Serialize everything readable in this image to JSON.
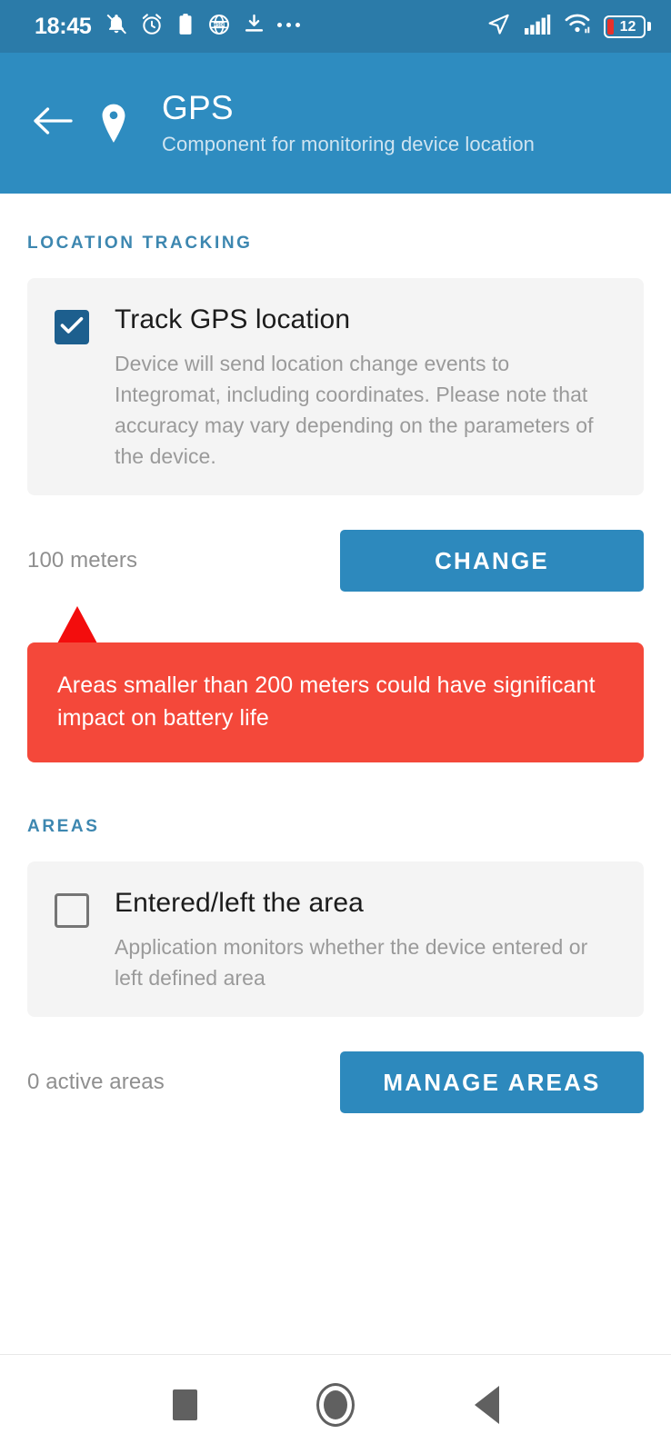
{
  "status_bar": {
    "time": "18:45",
    "icons_left": [
      "bell-muted-icon",
      "alarm-clock-icon",
      "clipboard-icon",
      "globe-wsdp-icon",
      "download-icon",
      "more-dots-icon"
    ],
    "icons_right": [
      "navigation-arrow-icon",
      "cellular-signal-icon",
      "wifi-icon"
    ],
    "battery_level": "12",
    "background_color": "#2b7ba9"
  },
  "header": {
    "back_icon": "arrow-left-icon",
    "location_icon": "map-pin-icon",
    "title": "GPS",
    "subtitle": "Component for monitoring device location",
    "background_color": "#2e8cc0"
  },
  "sections": {
    "location_tracking": {
      "label": "LOCATION TRACKING",
      "card": {
        "checked": true,
        "title": "Track GPS location",
        "description": "Device will send location change events to Integromat, including coordinates. Please note that accuracy may vary depending on the parameters of the device."
      },
      "action": {
        "value": "100 meters",
        "button_label": "CHANGE"
      },
      "warning": {
        "text": "Areas smaller than 200 meters could have significant impact on battery life",
        "box_color": "#f4483a",
        "arrow_color": "#f30d0d"
      }
    },
    "areas": {
      "label": "AREAS",
      "card": {
        "checked": false,
        "title": "Entered/left the area",
        "description": "Application monitors whether the device entered or left defined area"
      },
      "action": {
        "value": "0 active areas",
        "button_label": "MANAGE AREAS"
      }
    }
  },
  "nav_bar": {
    "recents": "recents-square-icon",
    "home": "home-circle-icon",
    "back": "back-triangle-icon"
  },
  "colors": {
    "accent": "#2d89bd",
    "section_label": "#3d87b0",
    "checkbox_checked": "#1d5f8e",
    "card_bg": "#f4f4f4"
  }
}
